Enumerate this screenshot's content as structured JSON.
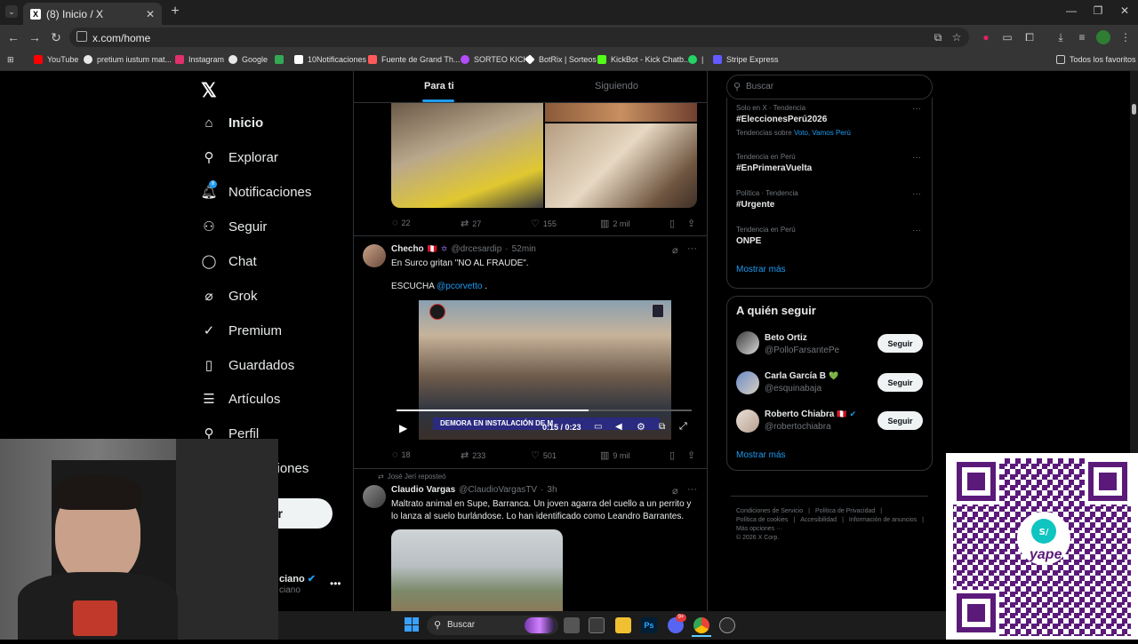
{
  "browser": {
    "tab_title": "(8) Inicio / X",
    "tab_icon": "x-logo-icon",
    "url": "x.com/home",
    "bookmarks": [
      {
        "label": "YouTube",
        "color": "#ff0000"
      },
      {
        "label": "pretium iustum mat...",
        "color": "#4285f4"
      },
      {
        "label": "Instagram",
        "color": "#e1306c"
      },
      {
        "label": "Google",
        "color": "#4285f4"
      },
      {
        "label": "",
        "color": "#34a853"
      },
      {
        "label": "10Notificaciones",
        "color": "#ffffff"
      },
      {
        "label": "Fuente de Grand Th...",
        "color": "#ff5a5a"
      },
      {
        "label": "SORTEO KICK",
        "color": "#b44cff"
      },
      {
        "label": "BotRix | Sorteos",
        "color": "#ffffff"
      },
      {
        "label": "KickBot - Kick Chatb...",
        "color": "#53fc18"
      },
      {
        "label": "|",
        "color": "#25d366"
      },
      {
        "label": "Stripe Express",
        "color": "#635bff"
      }
    ],
    "all_bookmarks": "Todos los favoritos"
  },
  "nav": {
    "items": [
      {
        "label": "Inicio",
        "icon": "home-icon",
        "badge": ""
      },
      {
        "label": "Explorar",
        "icon": "search-icon",
        "badge": ""
      },
      {
        "label": "Notificaciones",
        "icon": "bell-icon",
        "badge": "8"
      },
      {
        "label": "Seguir",
        "icon": "add-user-icon",
        "badge": ""
      },
      {
        "label": "Chat",
        "icon": "chat-icon",
        "badge": ""
      },
      {
        "label": "Grok",
        "icon": "grok-icon",
        "badge": ""
      },
      {
        "label": "Premium",
        "icon": "premium-icon",
        "badge": ""
      },
      {
        "label": "Guardados",
        "icon": "bookmark-icon",
        "badge": ""
      },
      {
        "label": "Artículos",
        "icon": "articles-icon",
        "badge": ""
      },
      {
        "label": "Perfil",
        "icon": "profile-icon",
        "badge": ""
      },
      {
        "label": "ciones",
        "icon": "more-icon",
        "badge": ""
      }
    ],
    "post_button": "r",
    "account_name": "ciano",
    "account_handle": "ciano"
  },
  "feed": {
    "tabs": [
      "Para ti",
      "Siguiendo"
    ],
    "first_post_actions": {
      "replies": "22",
      "reposts": "27",
      "likes": "155",
      "views": "2 mil"
    },
    "second_post": {
      "name": "Checho",
      "handle": "@drcesardip",
      "time": "52min",
      "line1": "En Surco gritan \"NO AL FRAUDE\".",
      "line2_prefix": "ESCUCHA",
      "mention": "@pcorvetto",
      "line2_suffix": ".",
      "video_time": "0:15 / 0:23",
      "video_caption": "DEMORA EN INSTALACIÓN DE M",
      "video_progress": 0.65,
      "actions": {
        "replies": "18",
        "reposts": "233",
        "likes": "501",
        "views": "9 mil"
      }
    },
    "third_post": {
      "repost_by": "José Jerí reposteó",
      "name": "Claudio Vargas",
      "handle": "@ClaudioVargasTV",
      "time": "3h",
      "text1": "Maltrato animal en Supe, Barranca. Un joven agarra del cuello a un perrito y",
      "text2": "lo lanza al suelo burlándose. Lo han identificado como Leandro Barrantes."
    }
  },
  "sidebar": {
    "search_placeholder": "Buscar",
    "trends": [
      {
        "meta": "Solo en X · Tendencia",
        "name": "#EleccionesPerú2026",
        "extra_prefix": "Tendencias sobre",
        "extra_links": "Voto, Vamos Perú"
      },
      {
        "meta": "Tendencia en Perú",
        "name": "#EnPrimeraVuelta",
        "extra_prefix": "",
        "extra_links": ""
      },
      {
        "meta": "Política · Tendencia",
        "name": "#Urgente",
        "extra_prefix": "",
        "extra_links": ""
      },
      {
        "meta": "Tendencia en Perú",
        "name": "ONPE",
        "extra_prefix": "",
        "extra_links": ""
      }
    ],
    "show_more": "Mostrar más",
    "who_to_follow_title": "A quién seguir",
    "who_to_follow": [
      {
        "name": "Beto Ortiz",
        "handle": "@PolloFarsantePe",
        "badge": ""
      },
      {
        "name": "Carla García B",
        "handle": "@esquinabaja",
        "badge": "💚"
      },
      {
        "name": "Roberto Chiabra",
        "handle": "@robertochiabra",
        "badge": ""
      }
    ],
    "follow_label": "Seguir",
    "show_more_2": "Mostrar más",
    "footer": [
      "Condiciones de Servicio",
      "|",
      "Política de Privacidad",
      "|",
      "Política de cookies",
      "|",
      "Accesibilidad",
      "|",
      "Información de anuncios",
      "|",
      "Más opciones ···",
      "© 2026 X Corp."
    ]
  },
  "taskbar": {
    "search_placeholder": "Buscar",
    "discord_badge": "9+"
  },
  "overlay": {
    "qr_brand": "yape"
  }
}
